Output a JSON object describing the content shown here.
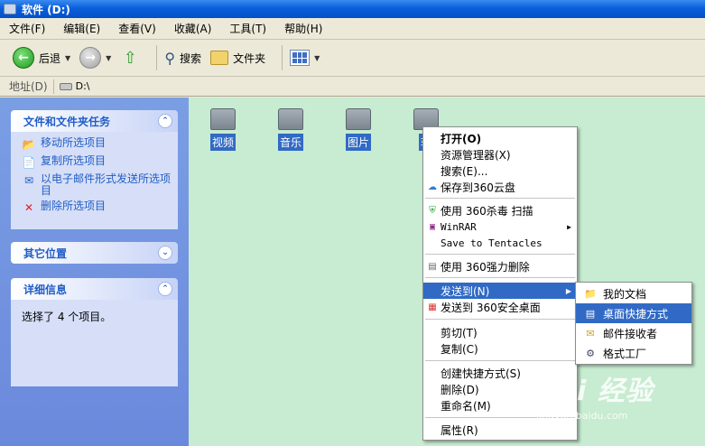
{
  "window": {
    "title": "软件 (D:)"
  },
  "menu": [
    "文件(F)",
    "编辑(E)",
    "查看(V)",
    "收藏(A)",
    "工具(T)",
    "帮助(H)"
  ],
  "toolbar": {
    "back": "后退",
    "search": "搜索",
    "folders": "文件夹"
  },
  "address": {
    "label": "地址(D)",
    "value": "D:\\"
  },
  "tasks_panel": {
    "title": "文件和文件夹任务",
    "items": [
      "移动所选项目",
      "复制所选项目",
      "以电子邮件形式发送所选项目",
      "删除所选项目"
    ]
  },
  "other_places": {
    "title": "其它位置"
  },
  "details": {
    "title": "详细信息",
    "text": "选择了 4 个项目。"
  },
  "files": [
    "视频",
    "音乐",
    "图片",
    "软"
  ],
  "context_menu": {
    "open": "打开(O)",
    "explorer": "资源管理器(X)",
    "search": "搜索(E)...",
    "save_360": "保存到360云盘",
    "scan_360": "使用 360杀毒 扫描",
    "winrar": "WinRAR",
    "tentacles": "Save to Tentacles",
    "force_delete": "使用 360强力删除",
    "send_to": "发送到(N)",
    "send_360": "发送到 360安全桌面",
    "cut": "剪切(T)",
    "copy": "复制(C)",
    "shortcut": "创建快捷方式(S)",
    "delete": "删除(D)",
    "rename": "重命名(M)",
    "properties": "属性(R)"
  },
  "send_to_menu": [
    "我的文档",
    "桌面快捷方式",
    "邮件接收者",
    "格式工厂"
  ],
  "watermark": {
    "brand": "Bai 经验",
    "url": "jingyan.baidu.com"
  }
}
